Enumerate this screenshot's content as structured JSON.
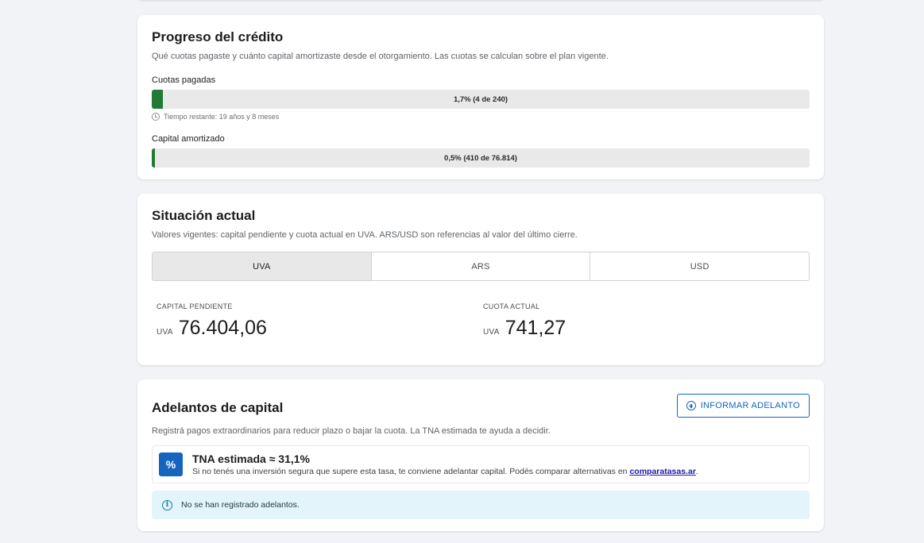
{
  "progreso": {
    "title": "Progreso del crédito",
    "subtitle": "Qué cuotas pagaste y cuánto capital amortizaste desde el otorgamiento. Las cuotas se calculan sobre el plan vigente.",
    "cuotas": {
      "label": "Cuotas pagadas",
      "bar_text": "1,7% (4 de 240)",
      "fraction": 0.017,
      "remaining": "Tiempo restante: 19 años y 8 meses"
    },
    "capital": {
      "label": "Capital amortizado",
      "bar_text": "0,5% (410 de 76.814)",
      "fraction": 0.005
    },
    "fill_color": "#217a35"
  },
  "situacion": {
    "title": "Situación actual",
    "subtitle": "Valores vigentes: capital pendiente y cuota actual en UVA. ARS/USD son referencias al valor del último cierre.",
    "tabs": [
      {
        "label": "UVA",
        "active": true
      },
      {
        "label": "ARS",
        "active": false
      },
      {
        "label": "USD",
        "active": false
      }
    ],
    "capital_pendiente": {
      "label": "CAPITAL PENDIENTE",
      "unit": "UVA",
      "value": "76.404,06"
    },
    "cuota_actual": {
      "label": "CUOTA ACTUAL",
      "unit": "UVA",
      "value": "741,27"
    }
  },
  "adelantos": {
    "title": "Adelantos de capital",
    "button_label": "INFORMAR ADELANTO",
    "subtitle": "Registrá pagos extraordinarios para reducir plazo o bajar la cuota. La TNA estimada te ayuda a decidir.",
    "tna": {
      "icon_glyph": "%",
      "title": "TNA estimada ≈ 31,1%",
      "desc_prefix": "Si no tenés una inversión segura que supere esta tasa, te conviene adelantar capital. Podés comparar alternativas en ",
      "link_text": "comparatasas.ar",
      "desc_suffix": "."
    },
    "info_text": "No se han registrado adelantos.",
    "accent_color": "#1565c0"
  }
}
